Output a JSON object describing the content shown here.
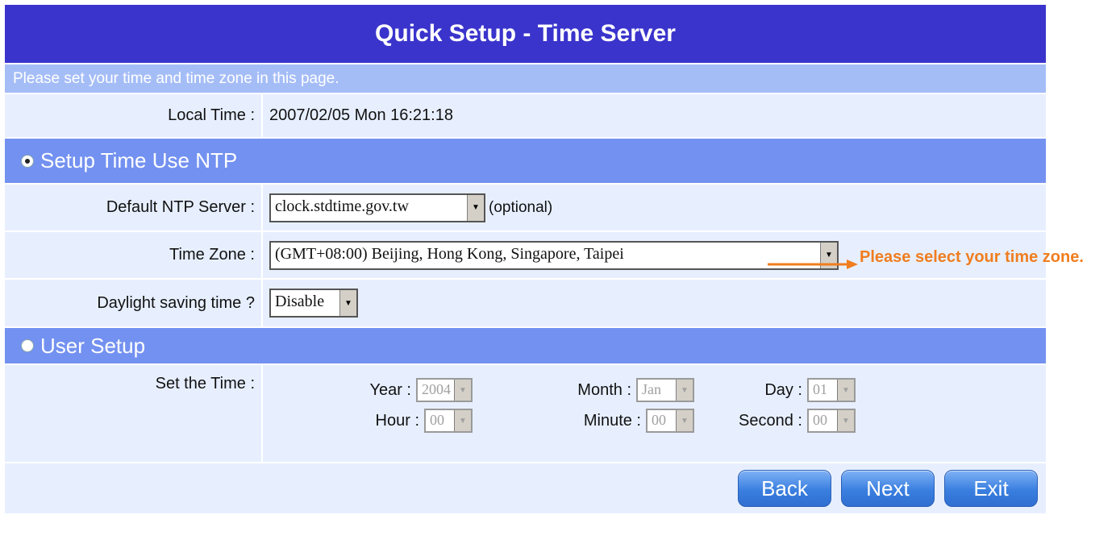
{
  "header": {
    "title": "Quick Setup - Time Server"
  },
  "info": {
    "text": "Please set your time and time zone in this page."
  },
  "local_time": {
    "label": "Local Time :",
    "value": "2007/02/05 Mon 16:21:18"
  },
  "ntp_section": {
    "label": "Setup Time Use NTP",
    "selected": true,
    "server": {
      "label": "Default NTP Server :",
      "value": "clock.stdtime.gov.tw",
      "hint": "(optional)"
    },
    "timezone": {
      "label": "Time Zone :",
      "value": "(GMT+08:00) Beijing, Hong Kong, Singapore, Taipei"
    },
    "daylight": {
      "label": "Daylight saving time ?",
      "value": "Disable"
    }
  },
  "user_section": {
    "label": "User Setup",
    "selected": false,
    "set_time_label": "Set the Time :",
    "year": {
      "label": "Year :",
      "value": "2004"
    },
    "month": {
      "label": "Month :",
      "value": "Jan"
    },
    "day": {
      "label": "Day :",
      "value": "01"
    },
    "hour": {
      "label": "Hour :",
      "value": "00"
    },
    "minute": {
      "label": "Minute :",
      "value": "00"
    },
    "second": {
      "label": "Second :",
      "value": "00"
    }
  },
  "buttons": {
    "back": "Back",
    "next": "Next",
    "exit": "Exit"
  },
  "annotation": {
    "text": "Please select your time zone.",
    "color": "#f07d1e"
  },
  "colors": {
    "title_bg": "#3a34cc",
    "section_bg": "#7391f0",
    "row_bg": "#e7efff",
    "info_bg": "#a5bdf7"
  }
}
